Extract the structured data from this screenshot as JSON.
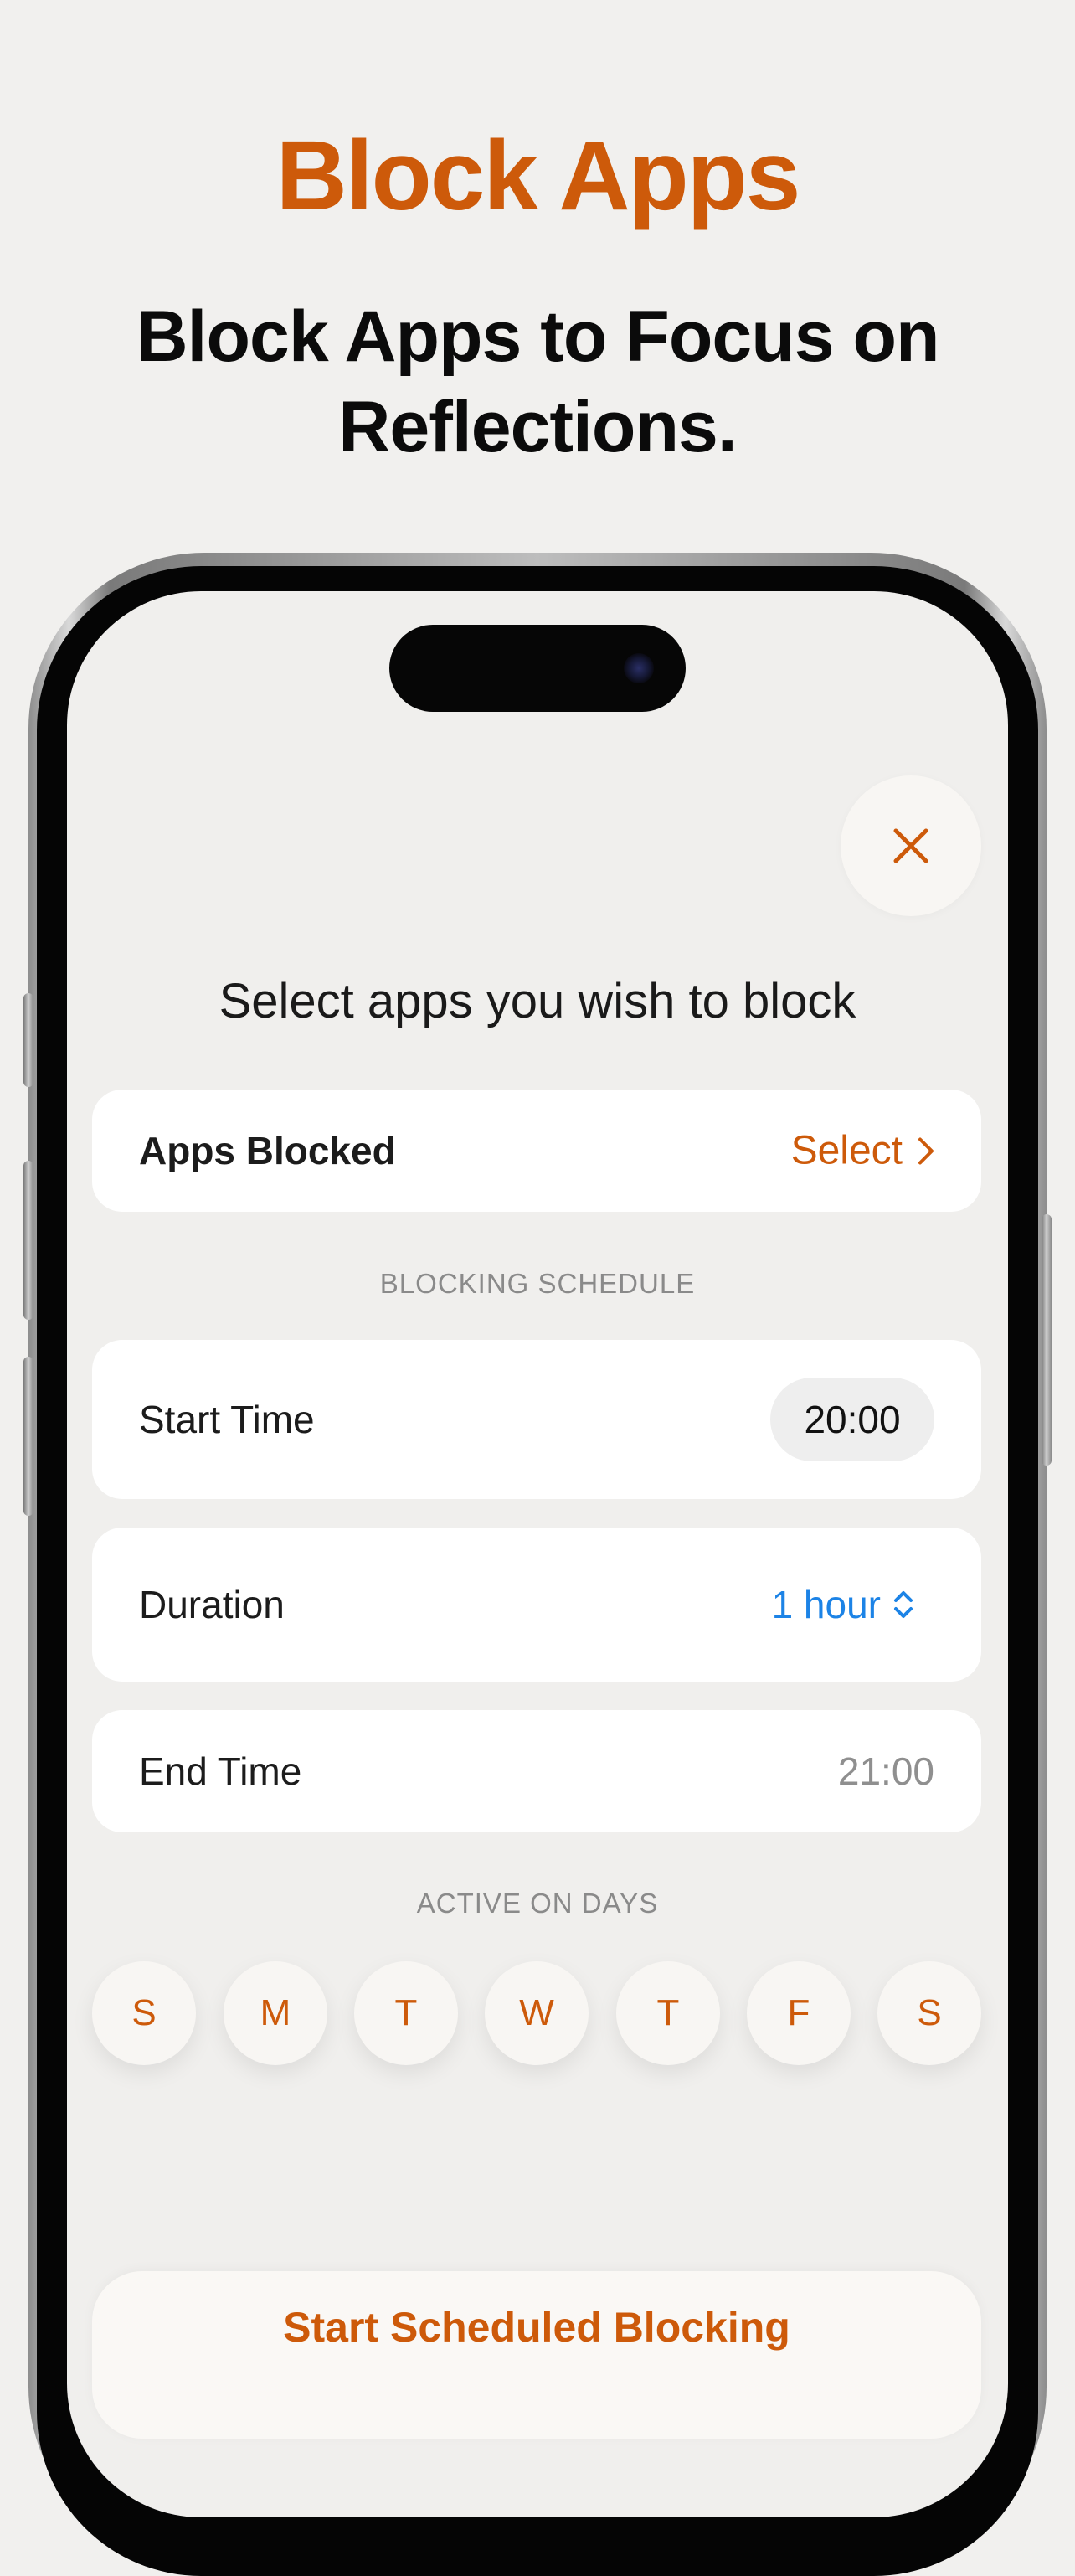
{
  "header": {
    "title": "Block Apps",
    "subtitle": "Block Apps to Focus on Reflections."
  },
  "screen": {
    "title": "Select apps you wish to block",
    "apps_blocked": {
      "label": "Apps Blocked",
      "action": "Select"
    },
    "schedule_section": "BLOCKING SCHEDULE",
    "start_time": {
      "label": "Start Time",
      "value": "20:00"
    },
    "duration": {
      "label": "Duration",
      "value": "1 hour"
    },
    "end_time": {
      "label": "End Time",
      "value": "21:00"
    },
    "days_section": "ACTIVE ON DAYS",
    "days": [
      "S",
      "M",
      "T",
      "W",
      "T",
      "F",
      "S"
    ],
    "start_button": "Start Scheduled Blocking"
  },
  "colors": {
    "accent": "#cd5a0a",
    "link_blue": "#1c83e6",
    "background": "#f1f0ee"
  },
  "icons": [
    "close-icon",
    "chevron-right-icon",
    "chevron-up-down-icon"
  ]
}
